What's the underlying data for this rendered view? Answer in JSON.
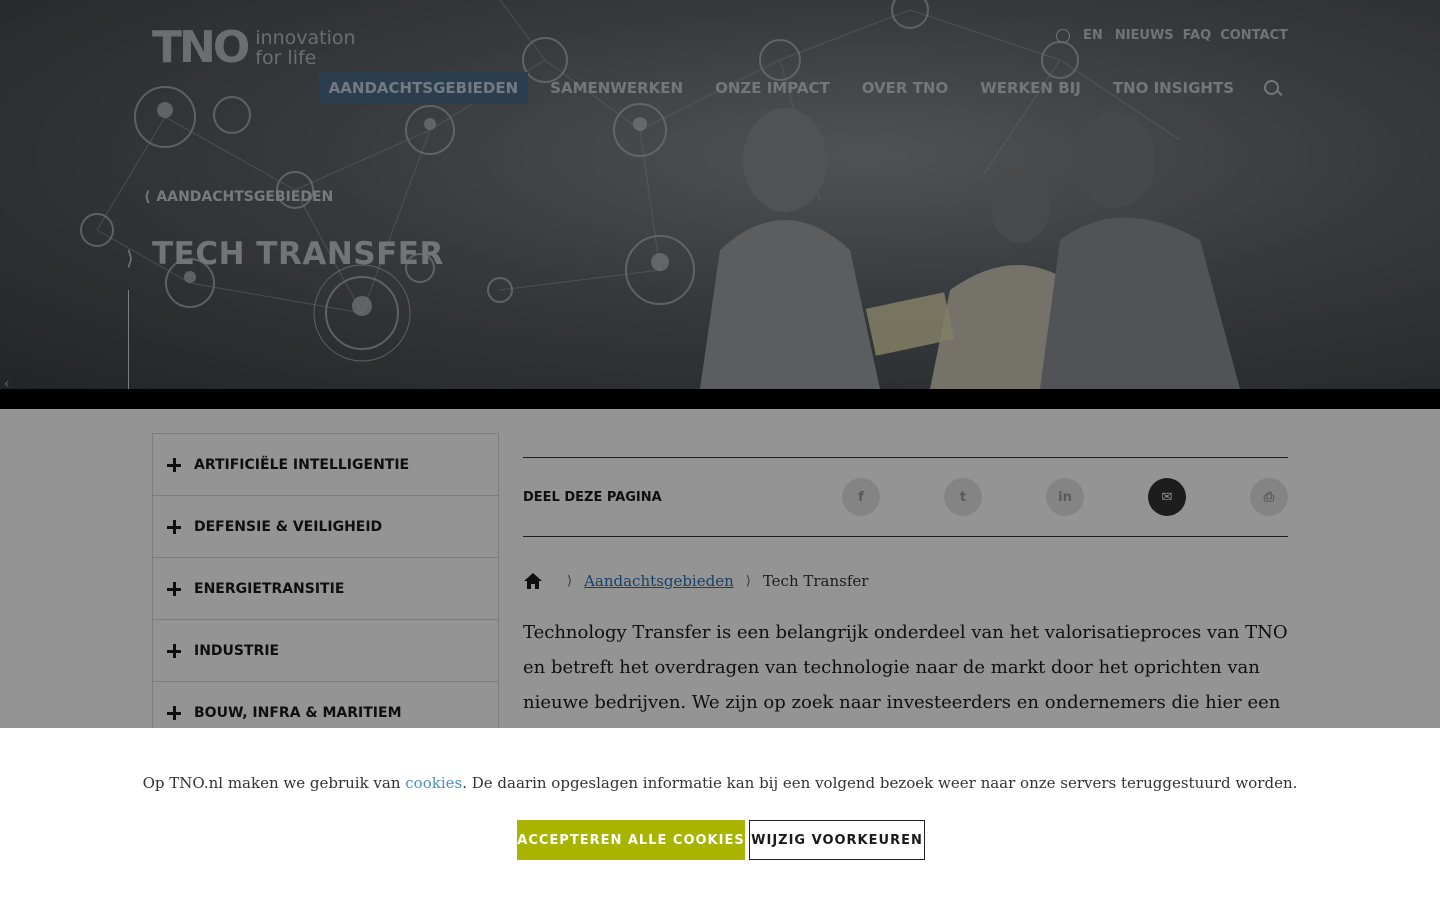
{
  "brand": {
    "logo_mark": "TNO",
    "tagline_line1": "innovation",
    "tagline_line2": "for life"
  },
  "utility_nav": {
    "language": "EN",
    "items": [
      "NIEUWS",
      "FAQ",
      "CONTACT"
    ]
  },
  "main_nav": {
    "items": [
      "AANDACHTSGEBIEDEN",
      "SAMENWERKEN",
      "ONZE IMPACT",
      "OVER TNO",
      "WERKEN BIJ",
      "TNO INSIGHTS"
    ],
    "active": "AANDACHTSGEBIEDEN"
  },
  "hero": {
    "back_link": "AANDACHTSGEBIEDEN",
    "title": "TECH TRANSFER"
  },
  "side_menu": {
    "items": [
      "ARTIFICIËLE INTELLIGENTIE",
      "DEFENSIE & VEILIGHEID",
      "ENERGIETRANSITIE",
      "INDUSTRIE",
      "BOUW, INFRA & MARITIEM"
    ]
  },
  "share": {
    "title": "DEEL DEZE PAGINA",
    "icons": [
      "facebook-icon",
      "twitter-icon",
      "linkedin-icon",
      "mail-icon",
      "print-icon"
    ]
  },
  "breadcrumb": {
    "items": [
      "Aandachtsgebieden",
      "Tech Transfer"
    ]
  },
  "intro": {
    "text": "Technology Transfer is een belangrijk onderdeel van het valorisatieproces van TNO en betreft het overdragen van technologie naar de markt door het oprichten van nieuwe bedrijven. We zijn op zoek naar investeerders en ondernemers die hier een rol bij kunnen spelen."
  },
  "cookie_bar": {
    "text_before": "Op TNO.nl maken we gebruik van ",
    "link": "cookies",
    "text_after": ". De daarin opgeslagen informatie kan bij een volgend bezoek weer naar onze servers teruggestuurd  worden.",
    "accept_label": "ACCEPTEREN ALLE COOKIES",
    "prefs_label": "WIJZIG VOORKEUREN"
  },
  "colors": {
    "accent_green": "#a9b400",
    "link_blue": "#4a90c8",
    "nav_active": "#4a6b8a"
  }
}
